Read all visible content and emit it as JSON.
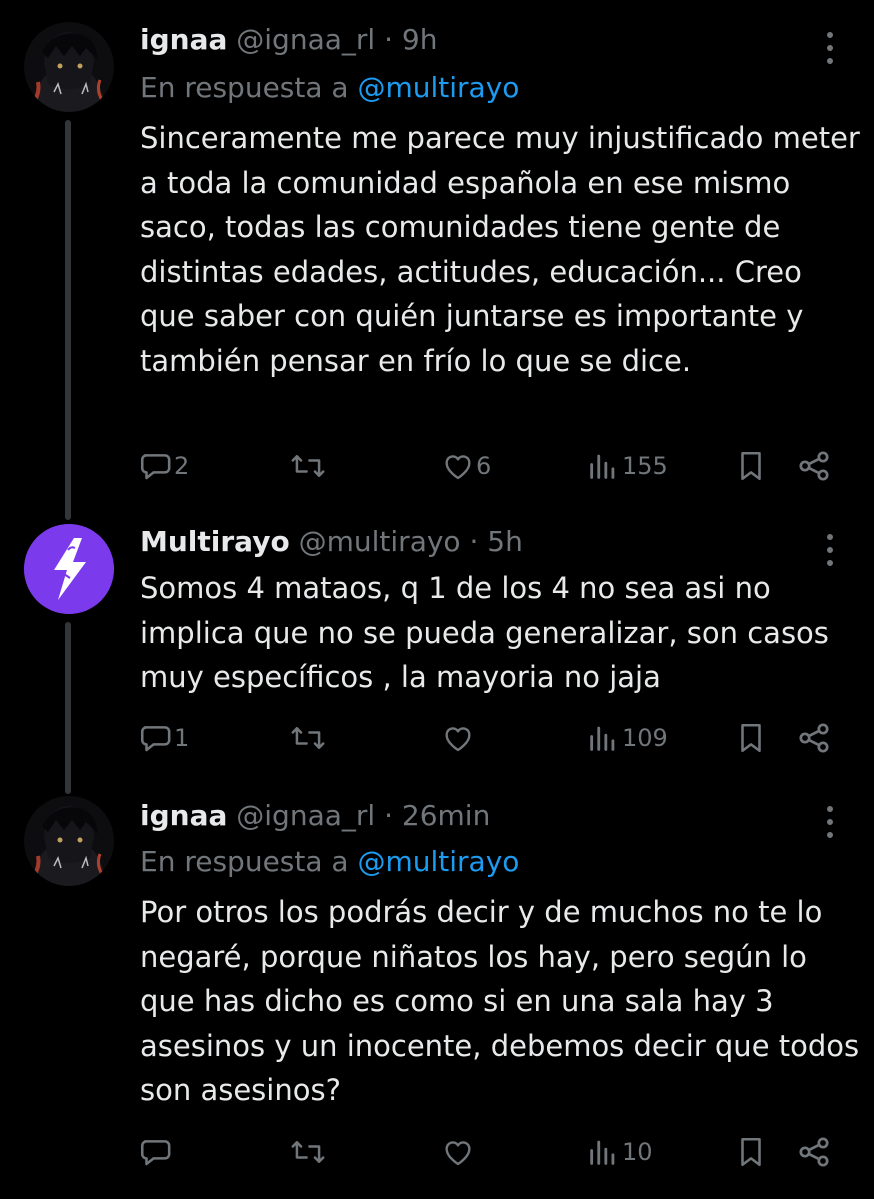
{
  "tweets": [
    {
      "name": "ignaa",
      "handle": "@ignaa_rl",
      "time": "9h",
      "reply_prefix": "En respuesta a",
      "reply_mention": "@multirayo",
      "text": "Sinceramente me parece muy injustificado meter a toda la comunidad española en ese mismo saco, todas las comunidades tiene gente de distintas edades, actitudes, educación... Creo que saber con quién juntarse es importante y también pensar en frío lo que se dice.",
      "replies": "2",
      "retweets": "",
      "likes": "6",
      "views": "155"
    },
    {
      "name": "Multirayo",
      "handle": "@multirayo",
      "time": "5h",
      "text": "Somos 4 mataos, q 1 de los 4 no sea asi no implica que no se pueda generalizar, son casos muy específicos , la mayoria no jaja",
      "replies": "1",
      "retweets": "",
      "likes": "",
      "views": "109"
    },
    {
      "name": "ignaa",
      "handle": "@ignaa_rl",
      "time": "26min",
      "reply_prefix": "En respuesta a",
      "reply_mention": "@multirayo",
      "text": "Por otros los podrás decir y de muchos no te lo negaré, porque niñatos los hay, pero según lo que has dicho es como si en una sala hay 3 asesinos y un inocente, debemos decir que todos son asesinos?",
      "replies": "",
      "retweets": "",
      "likes": "",
      "views": "10"
    }
  ],
  "icons": {
    "reply": "speech-bubble-icon",
    "retweet": "retweet-arrows-icon",
    "like": "heart-icon",
    "views": "bar-chart-icon",
    "bookmark": "bookmark-icon",
    "share": "share-icon",
    "more": "vertical-dots-icon"
  },
  "colors": {
    "background": "#000000",
    "text": "#e7e9ea",
    "muted": "#71767b",
    "mention": "#1d9bf0",
    "thread_line": "#333639",
    "multirayo_avatar": "#7c3aed"
  }
}
